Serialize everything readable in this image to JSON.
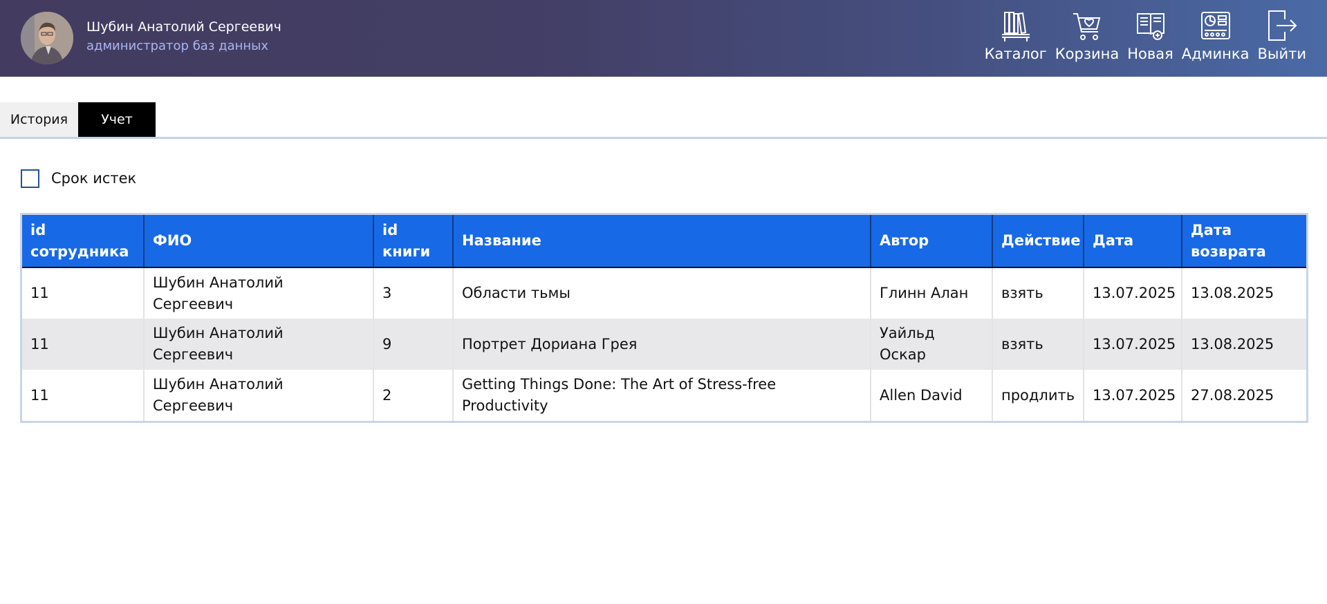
{
  "header": {
    "user_name": "Шубин Анатолий Сергеевич",
    "user_role": "администратор баз данных",
    "nav": [
      {
        "label": "Каталог",
        "icon": "bookshelf-icon"
      },
      {
        "label": "Корзина",
        "icon": "cart-icon"
      },
      {
        "label": "Новая",
        "icon": "new-book-icon"
      },
      {
        "label": "Админка",
        "icon": "admin-panel-icon"
      },
      {
        "label": "Выйти",
        "icon": "logout-icon"
      }
    ]
  },
  "tabs": {
    "history": "История",
    "account": "Учет",
    "active": "Учет"
  },
  "filter": {
    "label": "Срок истек",
    "checked": false
  },
  "table": {
    "columns": [
      "id сотрудника",
      "ФИО",
      "id книги",
      "Название",
      "Автор",
      "Действие",
      "Дата",
      "Дата возврата"
    ],
    "rows": [
      [
        "11",
        "Шубин Анатолий Сергеевич",
        "3",
        "Области тьмы",
        "Глинн Алан",
        "взять",
        "13.07.2025",
        "13.08.2025"
      ],
      [
        "11",
        "Шубин Анатолий Сергеевич",
        "9",
        "Портрет Дориана Грея",
        "Уайльд Оскар",
        "взять",
        "13.07.2025",
        "13.08.2025"
      ],
      [
        "11",
        "Шубин Анатолий Сергеевич",
        "2",
        "Getting Things Done: The Art of Stress-free Productivity",
        "Allen David",
        "продлить",
        "13.07.2025",
        "27.08.2025"
      ]
    ]
  },
  "colors": {
    "header_start": "#433c60",
    "header_end": "#4a6aa6",
    "table_header": "#1769e6",
    "active_tab": "#000000",
    "role_text": "#a9b6f0"
  }
}
